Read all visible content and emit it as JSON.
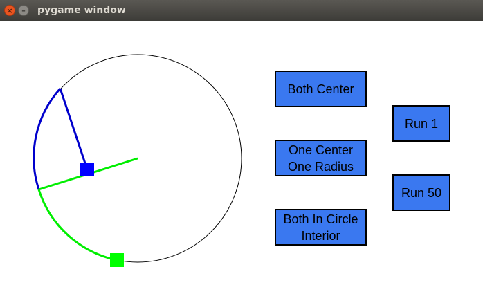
{
  "window": {
    "title": "pygame window",
    "close_glyph": "×",
    "minimize_glyph": "–"
  },
  "buttons": {
    "both_center": [
      "Both Center"
    ],
    "one_center_one_radius": [
      "One Center",
      "One Radius"
    ],
    "both_in_circle_interior": [
      "Both In Circle",
      "Interior"
    ],
    "run_1": [
      "Run 1"
    ],
    "run_50": [
      "Run 50"
    ]
  },
  "colors": {
    "button_fill": "#3a78f0",
    "circle_outline": "#000000",
    "blue_marker": "#0000ff",
    "blue_line": "#0000cc",
    "green_marker": "#00ff00",
    "green_line": "#00ee00"
  }
}
